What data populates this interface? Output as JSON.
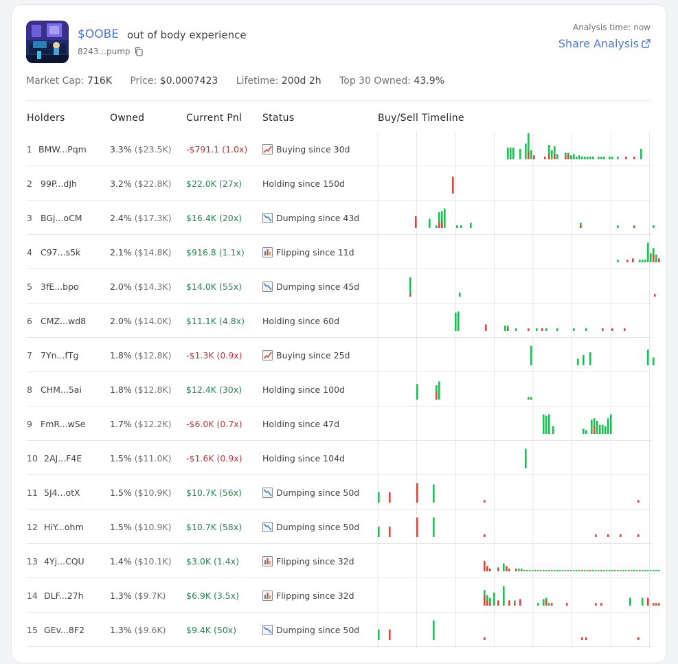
{
  "header": {
    "ticker": "$OOBE",
    "name": "out of body experience",
    "address": "8243...pump",
    "analysis_time": "Analysis time: now",
    "share_label": "Share Analysis"
  },
  "stats": {
    "market_cap_label": "Market Cap:",
    "market_cap": "716K",
    "price_label": "Price:",
    "price": "$0.0007423",
    "lifetime_label": "Lifetime:",
    "lifetime": "200d 2h",
    "top30_label": "Top 30 Owned:",
    "top30": "43.9%"
  },
  "columns": {
    "holders": "Holders",
    "owned": "Owned",
    "pnl": "Current Pnl",
    "status": "Status",
    "timeline": "Buy/Sell Timeline"
  },
  "colors": {
    "buy": "#22bb55",
    "sell": "#d9463e",
    "positive": "#23874f",
    "negative": "#c83232",
    "accent": "#4a78d4"
  },
  "rows": [
    {
      "rank": "1",
      "holder": "BMW...Pqm",
      "owned": "3.3%",
      "owned_usd": "($23.5K)",
      "pnl": "-$791.1 (1.0x)",
      "pnl_sign": "neg",
      "status": "Buying since 30d",
      "status_icon": "buying-chart-icon"
    },
    {
      "rank": "2",
      "holder": "99P...dJh",
      "owned": "3.2%",
      "owned_usd": "($22.8K)",
      "pnl": "$22.0K (27x)",
      "pnl_sign": "pos",
      "status": "Holding since 150d",
      "status_icon": ""
    },
    {
      "rank": "3",
      "holder": "BGj...oCM",
      "owned": "2.4%",
      "owned_usd": "($17.3K)",
      "pnl": "$16.4K (20x)",
      "pnl_sign": "pos",
      "status": "Dumping since 43d",
      "status_icon": "dumping-chart-icon"
    },
    {
      "rank": "4",
      "holder": "C97...s5k",
      "owned": "2.1%",
      "owned_usd": "($14.8K)",
      "pnl": "$916.8 (1.1x)",
      "pnl_sign": "pos",
      "status": "Flipping since 11d",
      "status_icon": "flipping-chart-icon"
    },
    {
      "rank": "5",
      "holder": "3fE...bpo",
      "owned": "2.0%",
      "owned_usd": "($14.3K)",
      "pnl": "$14.0K (55x)",
      "pnl_sign": "pos",
      "status": "Dumping since 45d",
      "status_icon": "dumping-chart-icon"
    },
    {
      "rank": "6",
      "holder": "CMZ...wd8",
      "owned": "2.0%",
      "owned_usd": "($14.0K)",
      "pnl": "$11.1K (4.8x)",
      "pnl_sign": "pos",
      "status": "Holding since 60d",
      "status_icon": ""
    },
    {
      "rank": "7",
      "holder": "7Yn...fTg",
      "owned": "1.8%",
      "owned_usd": "($12.8K)",
      "pnl": "-$1.3K (0.9x)",
      "pnl_sign": "neg",
      "status": "Buying since 25d",
      "status_icon": "buying-chart-icon"
    },
    {
      "rank": "8",
      "holder": "CHM...5ai",
      "owned": "1.8%",
      "owned_usd": "($12.8K)",
      "pnl": "$12.4K (30x)",
      "pnl_sign": "pos",
      "status": "Holding since 100d",
      "status_icon": ""
    },
    {
      "rank": "9",
      "holder": "FmR...wSe",
      "owned": "1.7%",
      "owned_usd": "($12.2K)",
      "pnl": "-$6.0K (0.7x)",
      "pnl_sign": "neg",
      "status": "Holding since 47d",
      "status_icon": ""
    },
    {
      "rank": "10",
      "holder": "2AJ...F4E",
      "owned": "1.5%",
      "owned_usd": "($11.0K)",
      "pnl": "-$1.6K (0.9x)",
      "pnl_sign": "neg",
      "status": "Holding since 104d",
      "status_icon": ""
    },
    {
      "rank": "11",
      "holder": "5J4...otX",
      "owned": "1.5%",
      "owned_usd": "($10.9K)",
      "pnl": "$10.7K (56x)",
      "pnl_sign": "pos",
      "status": "Dumping since 50d",
      "status_icon": "dumping-chart-icon"
    },
    {
      "rank": "12",
      "holder": "HiY...ohm",
      "owned": "1.5%",
      "owned_usd": "($10.9K)",
      "pnl": "$10.7K (58x)",
      "pnl_sign": "pos",
      "status": "Dumping since 50d",
      "status_icon": "dumping-chart-icon"
    },
    {
      "rank": "13",
      "holder": "4Yj...CQU",
      "owned": "1.4%",
      "owned_usd": "($10.1K)",
      "pnl": "$3.0K (1.4x)",
      "pnl_sign": "pos",
      "status": "Flipping since 32d",
      "status_icon": "flipping-chart-icon"
    },
    {
      "rank": "14",
      "holder": "DLF...27h",
      "owned": "1.3%",
      "owned_usd": "($9.7K)",
      "pnl": "$6.9K (3.5x)",
      "pnl_sign": "pos",
      "status": "Flipping since 32d",
      "status_icon": "flipping-chart-icon"
    },
    {
      "rank": "15",
      "holder": "GEv...8F2",
      "owned": "1.3%",
      "owned_usd": "($9.6K)",
      "pnl": "$9.4K (50x)",
      "pnl_sign": "pos",
      "status": "Dumping since 50d",
      "status_icon": "dumping-chart-icon"
    }
  ],
  "timeline": {
    "days": 200,
    "rows": [
      [
        {
          "d": 94,
          "b": 0.45
        },
        {
          "d": 96,
          "b": 0.45
        },
        {
          "d": 98,
          "b": 0.45
        },
        {
          "d": 103,
          "b": 0.4
        },
        {
          "d": 107,
          "b": 0.6
        },
        {
          "d": 109,
          "b": 1.0,
          "s": 0.3
        },
        {
          "d": 111,
          "b": 0.35
        },
        {
          "d": 113,
          "b": 0.1,
          "s": 0.15
        },
        {
          "d": 121,
          "s": 0.1
        },
        {
          "d": 124,
          "b": 0.55,
          "s": 0.2
        },
        {
          "d": 126,
          "b": 0.35
        },
        {
          "d": 128,
          "b": 0.5,
          "s": 0.2
        },
        {
          "d": 130,
          "b": 0.2
        },
        {
          "d": 136,
          "b": 0.25,
          "s": 0.1
        },
        {
          "d": 138,
          "b": 0.25,
          "s": 0.2
        },
        {
          "d": 140,
          "b": 0.15
        },
        {
          "d": 142,
          "b": 0.2
        },
        {
          "d": 144,
          "b": 0.1
        },
        {
          "d": 146,
          "b": 0.15
        },
        {
          "d": 148,
          "b": 0.1
        },
        {
          "d": 150,
          "b": 0.1
        },
        {
          "d": 152,
          "b": 0.1
        },
        {
          "d": 154,
          "b": 0.1
        },
        {
          "d": 156,
          "b": 0.1
        },
        {
          "d": 160,
          "b": 0.1
        },
        {
          "d": 162,
          "b": 0.1
        },
        {
          "d": 164,
          "b": 0.1
        },
        {
          "d": 168,
          "b": 0.1
        },
        {
          "d": 170,
          "b": 0.1
        },
        {
          "d": 174,
          "b": 0.1
        },
        {
          "d": 180,
          "s": 0.1
        },
        {
          "d": 186,
          "s": 0.1
        },
        {
          "d": 191,
          "b": 0.4
        }
      ],
      [
        {
          "d": 54,
          "b": 0.3,
          "s": 0.65
        }
      ],
      [
        {
          "d": 27,
          "s": 0.45
        },
        {
          "d": 37,
          "b": 0.35
        },
        {
          "d": 42,
          "b": 0.1
        },
        {
          "d": 44,
          "b": 0.6,
          "s": 0.2
        },
        {
          "d": 46,
          "b": 0.65,
          "s": 0.25
        },
        {
          "d": 48,
          "b": 0.75
        },
        {
          "d": 57,
          "b": 0.1
        },
        {
          "d": 60,
          "b": 0.1
        },
        {
          "d": 67,
          "b": 0.2
        },
        {
          "d": 147,
          "b": 0.2,
          "s": 0.1
        },
        {
          "d": 174,
          "b": 0.1
        },
        {
          "d": 186,
          "b": 0.1,
          "s": 0.05
        },
        {
          "d": 200,
          "b": 0.1
        }
      ],
      [
        {
          "d": 174,
          "b": 0.1
        },
        {
          "d": 181,
          "s": 0.1
        },
        {
          "d": 185,
          "s": 0.15
        },
        {
          "d": 190,
          "b": 0.1
        },
        {
          "d": 192,
          "b": 0.1
        },
        {
          "d": 194,
          "b": 0.1
        },
        {
          "d": 196,
          "b": 0.75
        },
        {
          "d": 198,
          "b": 0.35
        },
        {
          "d": 200,
          "b": 0.55,
          "s": 0.3
        },
        {
          "d": 202,
          "b": 0.3
        },
        {
          "d": 204,
          "s": 0.15
        }
      ],
      [
        {
          "d": 23,
          "b": 0.75,
          "s": 0.1
        },
        {
          "d": 59,
          "b": 0.15
        },
        {
          "d": 201,
          "s": 0.1
        }
      ],
      [
        {
          "d": 56,
          "b": 0.7
        },
        {
          "d": 58,
          "b": 0.75
        },
        {
          "d": 78,
          "s": 0.25
        },
        {
          "d": 92,
          "b": 0.2
        },
        {
          "d": 94,
          "b": 0.2,
          "s": 0.1
        },
        {
          "d": 100,
          "b": 0.1
        },
        {
          "d": 109,
          "s": 0.1
        },
        {
          "d": 115,
          "b": 0.1
        },
        {
          "d": 119,
          "s": 0.1
        },
        {
          "d": 122,
          "b": 0.1
        },
        {
          "d": 130,
          "b": 0.1
        },
        {
          "d": 142,
          "b": 0.1
        },
        {
          "d": 151,
          "b": 0.1
        },
        {
          "d": 163,
          "s": 0.1
        },
        {
          "d": 170,
          "s": 0.1
        },
        {
          "d": 179,
          "s": 0.1
        }
      ],
      [
        {
          "d": 111,
          "b": 0.75
        },
        {
          "d": 145,
          "b": 0.25
        },
        {
          "d": 149,
          "b": 0.4
        },
        {
          "d": 154,
          "b": 0.5
        },
        {
          "d": 196,
          "b": 0.6
        },
        {
          "d": 200,
          "b": 0.3
        }
      ],
      [
        {
          "d": 28,
          "b": 0.6
        },
        {
          "d": 42,
          "b": 0.55,
          "s": 0.3
        },
        {
          "d": 44,
          "b": 0.7
        },
        {
          "d": 109,
          "b": 0.1
        },
        {
          "d": 111,
          "b": 0.1
        }
      ],
      [
        {
          "d": 120,
          "b": 0.75
        },
        {
          "d": 122,
          "b": 0.7
        },
        {
          "d": 124,
          "b": 0.75
        },
        {
          "d": 127,
          "b": 0.3
        },
        {
          "d": 149,
          "b": 0.2
        },
        {
          "d": 151,
          "b": 0.15
        },
        {
          "d": 155,
          "b": 0.55
        },
        {
          "d": 157,
          "b": 0.6,
          "s": 0.3
        },
        {
          "d": 159,
          "b": 0.5
        },
        {
          "d": 161,
          "b": 0.35
        },
        {
          "d": 163,
          "b": 0.35
        },
        {
          "d": 165,
          "b": 0.3
        },
        {
          "d": 167,
          "b": 0.6
        },
        {
          "d": 169,
          "b": 0.75
        }
      ],
      [
        {
          "d": 107,
          "b": 0.75
        }
      ],
      [
        {
          "d": 0,
          "b": 0.4
        },
        {
          "d": 8,
          "s": 0.4
        },
        {
          "d": 28,
          "s": 0.75
        },
        {
          "d": 40,
          "b": 0.7
        },
        {
          "d": 77,
          "s": 0.1
        },
        {
          "d": 189,
          "s": 0.1
        }
      ],
      [
        {
          "d": 0,
          "b": 0.4
        },
        {
          "d": 8,
          "s": 0.4
        },
        {
          "d": 28,
          "s": 0.75
        },
        {
          "d": 40,
          "b": 0.75
        },
        {
          "d": 77,
          "s": 0.1
        },
        {
          "d": 158,
          "s": 0.1
        },
        {
          "d": 167,
          "s": 0.1
        },
        {
          "d": 176,
          "s": 0.1
        },
        {
          "d": 189,
          "s": 0.1
        }
      ],
      [
        {
          "d": 77,
          "b": 0.3,
          "s": 0.4
        },
        {
          "d": 79,
          "s": 0.2
        },
        {
          "d": 81,
          "b": 0.1,
          "s": 0.1
        },
        {
          "d": 87,
          "b": 0.15,
          "s": 0.1
        },
        {
          "d": 91,
          "b": 0.3
        },
        {
          "d": 93,
          "b": 0.2,
          "s": 0.2
        },
        {
          "d": 95,
          "b": 0.1,
          "s": 0.1
        },
        {
          "d": 100,
          "s": 0.1
        },
        {
          "d": 102,
          "b": 0.1
        },
        {
          "d": 104,
          "b": 0.1
        },
        {
          "d": 106,
          "s": 0.05
        },
        {
          "d": 108,
          "b": 0.05
        },
        {
          "d": 110,
          "b": 0.05
        },
        {
          "d": 112,
          "b": 0.05
        },
        {
          "d": 114,
          "s": 0.05
        },
        {
          "d": 116,
          "b": 0.05
        },
        {
          "d": 118,
          "b": 0.05
        },
        {
          "d": 120,
          "s": 0.05
        },
        {
          "d": 122,
          "b": 0.05
        },
        {
          "d": 124,
          "b": 0.05
        },
        {
          "d": 126,
          "s": 0.05
        },
        {
          "d": 128,
          "b": 0.05
        },
        {
          "d": 130,
          "b": 0.05
        },
        {
          "d": 132,
          "b": 0.05
        },
        {
          "d": 134,
          "b": 0.05
        },
        {
          "d": 136,
          "b": 0.05
        },
        {
          "d": 138,
          "s": 0.05
        },
        {
          "d": 140,
          "b": 0.05
        },
        {
          "d": 142,
          "b": 0.05
        },
        {
          "d": 144,
          "b": 0.05
        },
        {
          "d": 146,
          "b": 0.05
        },
        {
          "d": 148,
          "s": 0.05
        },
        {
          "d": 150,
          "b": 0.05
        },
        {
          "d": 152,
          "b": 0.05
        },
        {
          "d": 154,
          "s": 0.05
        },
        {
          "d": 156,
          "b": 0.05
        },
        {
          "d": 158,
          "b": 0.05
        },
        {
          "d": 160,
          "b": 0.05
        },
        {
          "d": 162,
          "s": 0.05
        },
        {
          "d": 164,
          "b": 0.05
        },
        {
          "d": 166,
          "b": 0.05
        },
        {
          "d": 168,
          "b": 0.05
        },
        {
          "d": 170,
          "b": 0.05
        },
        {
          "d": 172,
          "b": 0.05
        },
        {
          "d": 174,
          "s": 0.05
        },
        {
          "d": 176,
          "b": 0.05
        },
        {
          "d": 178,
          "b": 0.05
        },
        {
          "d": 180,
          "b": 0.05
        },
        {
          "d": 182,
          "s": 0.05
        },
        {
          "d": 184,
          "b": 0.05
        },
        {
          "d": 186,
          "b": 0.05
        },
        {
          "d": 188,
          "b": 0.05
        },
        {
          "d": 190,
          "s": 0.05
        },
        {
          "d": 192,
          "b": 0.05
        },
        {
          "d": 194,
          "b": 0.05
        },
        {
          "d": 196,
          "b": 0.05
        },
        {
          "d": 198,
          "b": 0.05
        },
        {
          "d": 200,
          "b": 0.05
        },
        {
          "d": 202,
          "b": 0.05
        },
        {
          "d": 204,
          "b": 0.05
        }
      ],
      [
        {
          "d": 77,
          "b": 0.6,
          "s": 0.4
        },
        {
          "d": 79,
          "b": 0.4,
          "s": 0.2
        },
        {
          "d": 81,
          "b": 0.3,
          "s": 0.1
        },
        {
          "d": 84,
          "b": 0.5
        },
        {
          "d": 87,
          "b": 0.2,
          "s": 0.2
        },
        {
          "d": 91,
          "b": 0.75
        },
        {
          "d": 95,
          "b": 0.2,
          "s": 0.2
        },
        {
          "d": 99,
          "b": 0.2,
          "s": 0.1
        },
        {
          "d": 103,
          "s": 0.25
        },
        {
          "d": 116,
          "b": 0.1
        },
        {
          "d": 120,
          "b": 0.25
        },
        {
          "d": 122,
          "b": 0.3,
          "s": 0.2
        },
        {
          "d": 124,
          "b": 0.1
        },
        {
          "d": 126,
          "s": 0.1
        },
        {
          "d": 137,
          "s": 0.1
        },
        {
          "d": 158,
          "s": 0.1
        },
        {
          "d": 162,
          "s": 0.1
        },
        {
          "d": 183,
          "b": 0.3
        },
        {
          "d": 192,
          "b": 0.3
        },
        {
          "d": 196,
          "s": 0.3
        },
        {
          "d": 200,
          "s": 0.1
        },
        {
          "d": 202,
          "s": 0.1
        },
        {
          "d": 204,
          "s": 0.1
        }
      ],
      [
        {
          "d": 0,
          "b": 0.4
        },
        {
          "d": 8,
          "s": 0.4
        },
        {
          "d": 40,
          "b": 0.75
        },
        {
          "d": 77,
          "s": 0.1
        },
        {
          "d": 148,
          "s": 0.1
        },
        {
          "d": 151,
          "s": 0.1
        },
        {
          "d": 189,
          "s": 0.1
        }
      ]
    ]
  }
}
